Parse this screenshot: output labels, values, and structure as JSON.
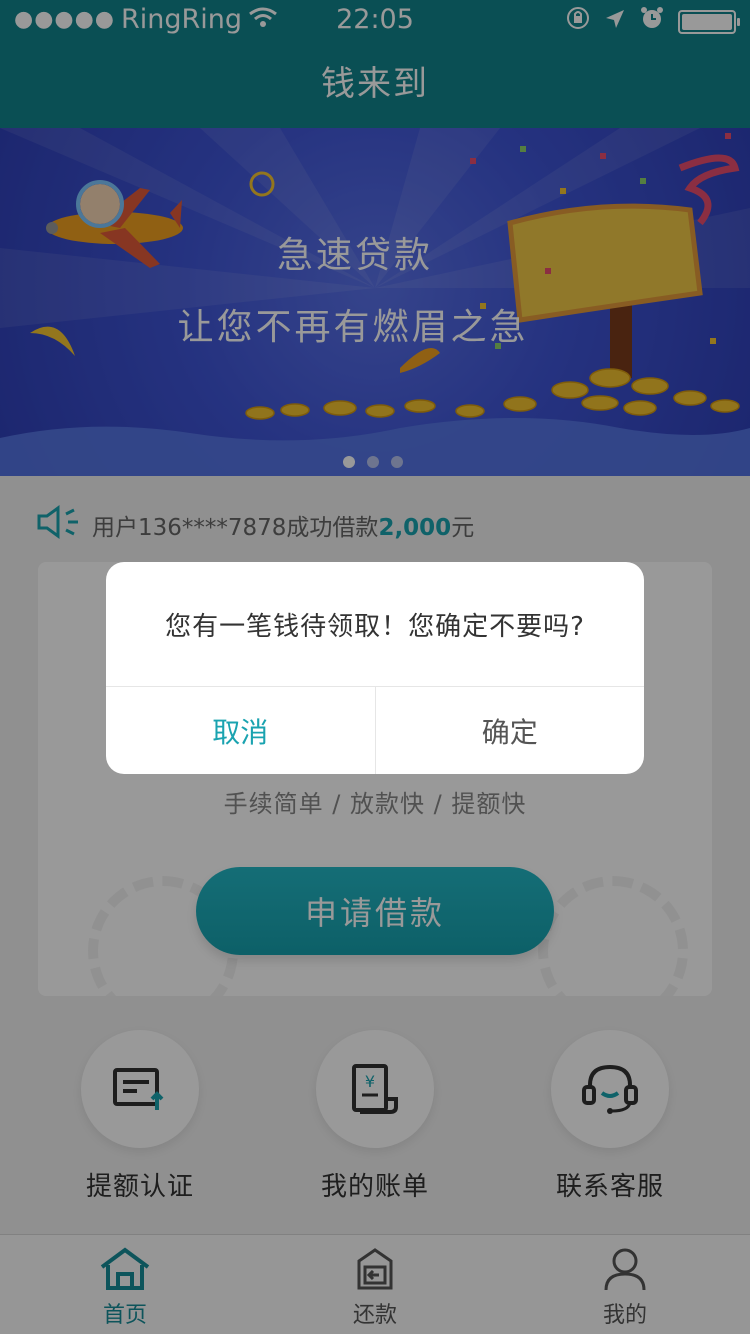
{
  "status_bar": {
    "signal": "●●●●●",
    "carrier": "RingRing",
    "time": "22:05",
    "icons": [
      "wifi-icon",
      "orientation-lock-icon",
      "location-icon",
      "alarm-icon",
      "battery-icon"
    ]
  },
  "nav": {
    "title": "钱来到"
  },
  "banner": {
    "line1": "急速贷款",
    "line2": "让您不再有燃眉之急",
    "pages": 3,
    "active_page": 1
  },
  "notice": {
    "icon": "speaker-icon",
    "prefix": "用户136****7878成功借款",
    "amount": "2,000",
    "suffix": "元"
  },
  "loan_card": {
    "features": "手续简单 / 放款快 / 提额快",
    "apply_label": "申请借款"
  },
  "shortcuts": [
    {
      "icon": "credit-card-upload-icon",
      "label": "提额认证"
    },
    {
      "icon": "bill-yuan-icon",
      "label": "我的账单"
    },
    {
      "icon": "headset-icon",
      "label": "联系客服"
    }
  ],
  "tabs": [
    {
      "icon": "home-icon",
      "label": "首页",
      "active": true
    },
    {
      "icon": "repay-icon",
      "label": "还款",
      "active": false
    },
    {
      "icon": "user-icon",
      "label": "我的",
      "active": false
    }
  ],
  "dialog": {
    "message": "您有一笔钱待领取！您确定不要吗?",
    "cancel_label": "取消",
    "confirm_label": "确定"
  },
  "colors": {
    "primary": "#12848c",
    "accent": "#1aa3b0",
    "banner_blue": "#3f55d6"
  }
}
